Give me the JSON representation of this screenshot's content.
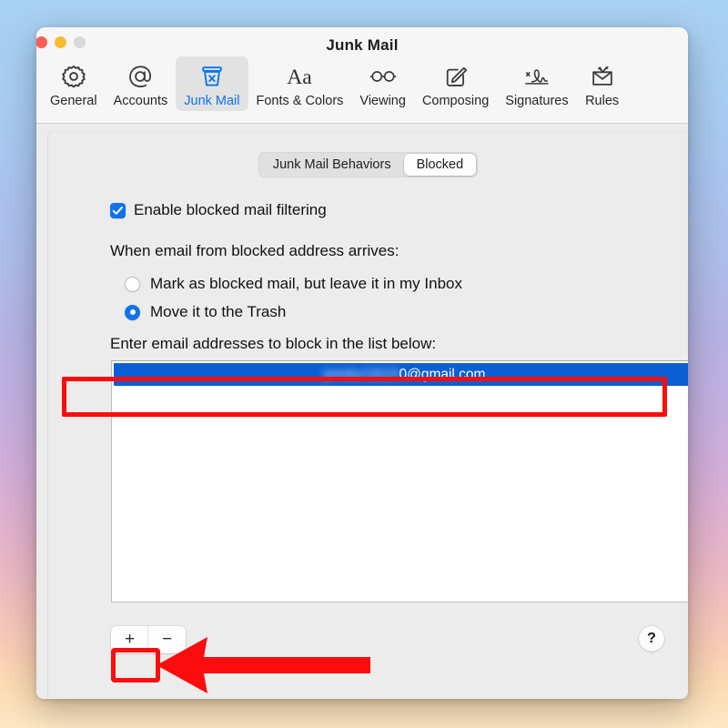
{
  "window": {
    "title": "Junk Mail",
    "traffic_lights": [
      "close",
      "minimize",
      "zoom"
    ]
  },
  "toolbar": {
    "items": [
      {
        "label": "General",
        "icon": "gear-icon",
        "selected": false
      },
      {
        "label": "Accounts",
        "icon": "at-sign-icon",
        "selected": false
      },
      {
        "label": "Junk Mail",
        "icon": "junk-bin-icon",
        "selected": true
      },
      {
        "label": "Fonts & Colors",
        "icon": "aa-text-icon",
        "selected": false
      },
      {
        "label": "Viewing",
        "icon": "glasses-icon",
        "selected": false
      },
      {
        "label": "Composing",
        "icon": "compose-pencil-icon",
        "selected": false
      },
      {
        "label": "Signatures",
        "icon": "signature-icon",
        "selected": false
      },
      {
        "label": "Rules",
        "icon": "rules-envelope-icon",
        "selected": false
      }
    ]
  },
  "segmented_control": {
    "options": [
      "Junk Mail Behaviors",
      "Blocked"
    ],
    "selected": "Blocked"
  },
  "form": {
    "enable_checkbox": {
      "label": "Enable blocked mail filtering",
      "checked": true
    },
    "when_label": "When email from blocked address arrives:",
    "radio_options": [
      {
        "label": "Mark as blocked mail, but leave it in my Inbox",
        "selected": false
      },
      {
        "label": "Move it to the Trash",
        "selected": true
      }
    ],
    "list_label": "Enter email addresses to block in the list below:",
    "list": {
      "rows": [
        {
          "redacted_part": "pmdur1610",
          "visible_part": "0@gmail.com",
          "selected": true
        }
      ]
    }
  },
  "bottom_bar": {
    "add_button": "+",
    "remove_button": "−",
    "help_button": "?"
  },
  "annotations": {
    "highlight_rect_color": "#fc0d0d",
    "arrow_color": "#fc0d0d",
    "arrow_direction": "left",
    "targets": [
      "blocked-address-list-row",
      "remove-address-button"
    ]
  },
  "colors": {
    "accent": "#0a74ef",
    "selection": "#0b5fd4",
    "checkbox": "#1272ec",
    "annotation": "#fc0d0d"
  }
}
